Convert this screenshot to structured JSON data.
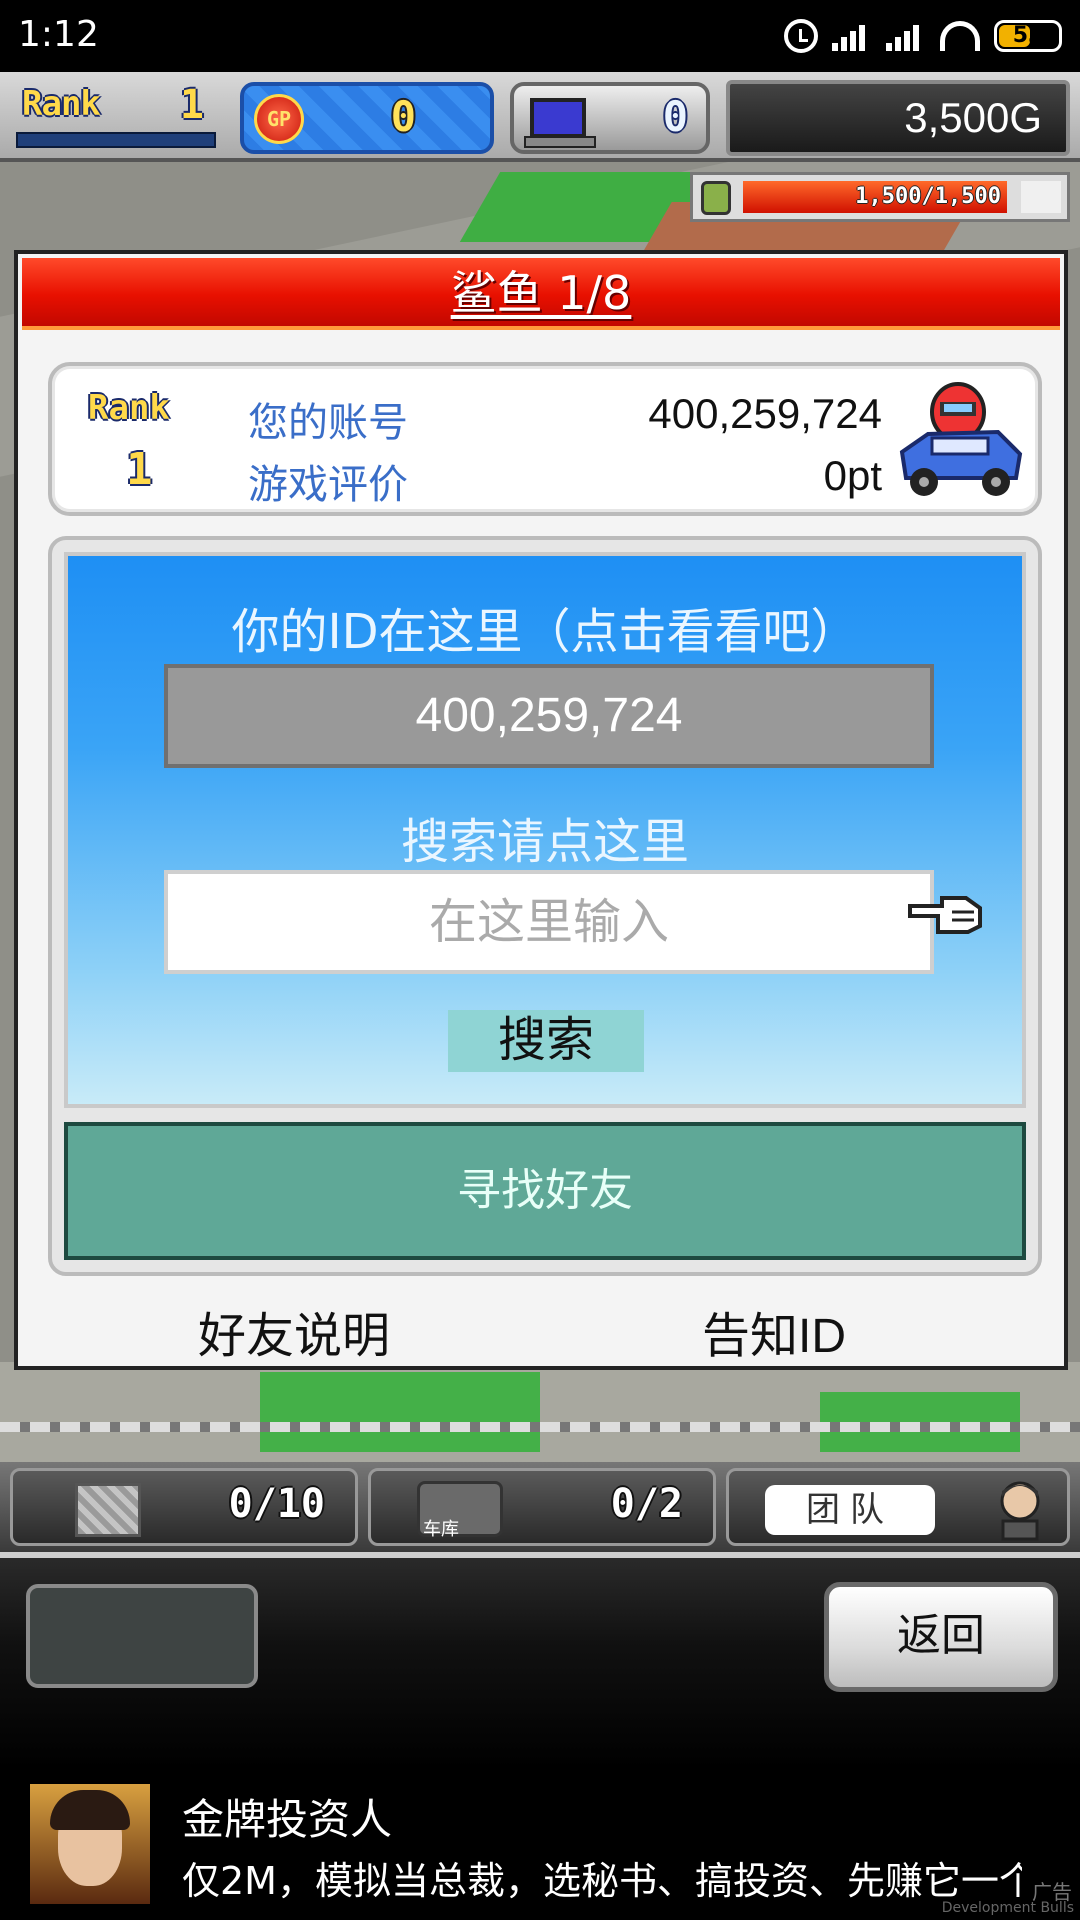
{
  "status_bar": {
    "time": "1:12",
    "battery": "53",
    "icons": [
      "alarm-icon",
      "signal-icon",
      "signal-icon",
      "wifi-icon",
      "battery-icon"
    ]
  },
  "hud": {
    "rank_label": "Rank",
    "rank_value": "1",
    "gp_icon_label": "GP",
    "gp_value": "0",
    "pc_value": "0",
    "money": "3,500G",
    "fuel": "1,500/1,500",
    "fuel_fraction": 1.0
  },
  "dialog": {
    "title": "鲨鱼 1/8",
    "profile": {
      "rank_label": "Rank",
      "rank_value": "1",
      "account_label": "您的账号",
      "account_value": "400,259,724",
      "rating_label": "游戏评价",
      "rating_value": "0pt"
    },
    "id_heading": "你的ID在这里（点击看看吧）",
    "id_value": "400,259,724",
    "search_heading": "搜索请点这里",
    "search_placeholder": "在这里输入",
    "search_button": "搜索",
    "find_friend_button": "寻找好友",
    "friend_help_link": "好友说明",
    "share_id_link": "告知ID"
  },
  "inventory": {
    "items_count": "0/10",
    "garage_label": "车库",
    "garage_count": "0/2",
    "team_label": "团队"
  },
  "controls": {
    "back_button": "返回"
  },
  "ad": {
    "title": "金牌投资人",
    "description": "仅2M，模拟当总裁，选秘书、搞投资、先赚它一个",
    "tag": "广告",
    "watermark": "Development Bulls"
  },
  "colors": {
    "title_bar": "#e81000",
    "id_area_top": "#1e8ff4",
    "find_friend": "#5fa897",
    "search_button": "#8fd4d4",
    "profile_label": "#3a6ec8"
  }
}
